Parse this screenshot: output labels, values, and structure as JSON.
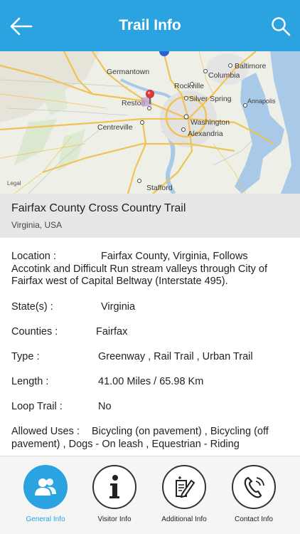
{
  "header": {
    "title": "Trail Info",
    "back_icon": "arrow-left-icon",
    "search_icon": "search-icon"
  },
  "map": {
    "places": [
      "Baltimore",
      "Germantown",
      "Columbia",
      "Rockville",
      "Silver Spring",
      "Annapolis",
      "Reston",
      "Centreville",
      "Washington",
      "Alexandria",
      "Stafford"
    ],
    "legal": "Legal"
  },
  "trail": {
    "name": "Fairfax County Cross Country Trail",
    "region": "Virginia, USA"
  },
  "details": {
    "location_label": "Location  :",
    "location_value_first": "Fairfax County, Virginia, Follows",
    "location_value_rest": "Accotink and Difficult Run stream valleys through City of Fairfax west of Capital Beltway (Interstate 495).",
    "states_label": "State(s)  :",
    "states_value": "Virginia",
    "counties_label": "Counties  :",
    "counties_value": "Fairfax",
    "type_label": "Type  :",
    "type_value": "Greenway , Rail Trail , Urban Trail",
    "length_label": "Length  :",
    "length_value": "41.00 Miles / 65.98 Km",
    "loop_label": "Loop Trail  :",
    "loop_value": "No",
    "uses_label": "Allowed Uses  :",
    "uses_value_first": "Bicycling (on pavement) , Bicycling (off",
    "uses_value_rest": "pavement) , Dogs - On leash , Equestrian - Riding"
  },
  "tabs": [
    {
      "label": "General Info",
      "icon": "people-icon",
      "active": true
    },
    {
      "label": "Visitor Info",
      "icon": "info-icon",
      "active": false
    },
    {
      "label": "Additional Info",
      "icon": "edit-document-icon",
      "active": false
    },
    {
      "label": "Contact Info",
      "icon": "phone-icon",
      "active": false
    }
  ],
  "colors": {
    "accent": "#2aa3e0",
    "header_text": "#ffffff",
    "subheader_bg": "#e7e7e7"
  }
}
